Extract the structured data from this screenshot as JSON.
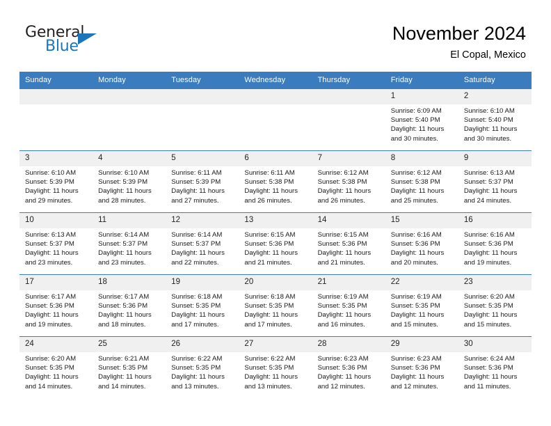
{
  "brand": {
    "name_part1": "General",
    "name_part2": "Blue",
    "triangle_color": "#1b75bb"
  },
  "header": {
    "month_title": "November 2024",
    "location": "El Copal, Mexico",
    "header_bg": "#3a7cbe",
    "daynum_bg": "#f0f0f0"
  },
  "weekday_headers": [
    "Sunday",
    "Monday",
    "Tuesday",
    "Wednesday",
    "Thursday",
    "Friday",
    "Saturday"
  ],
  "labels": {
    "sunrise_prefix": "Sunrise:",
    "sunset_prefix": "Sunset:",
    "daylight_prefix": "Daylight:"
  },
  "weeks": [
    [
      {
        "day": "",
        "empty": true
      },
      {
        "day": "",
        "empty": true
      },
      {
        "day": "",
        "empty": true
      },
      {
        "day": "",
        "empty": true
      },
      {
        "day": "",
        "empty": true
      },
      {
        "day": "1",
        "sunrise": "Sunrise: 6:09 AM",
        "sunset": "Sunset: 5:40 PM",
        "daylight_line1": "Daylight: 11 hours",
        "daylight_line2": "and 30 minutes."
      },
      {
        "day": "2",
        "sunrise": "Sunrise: 6:10 AM",
        "sunset": "Sunset: 5:40 PM",
        "daylight_line1": "Daylight: 11 hours",
        "daylight_line2": "and 30 minutes."
      }
    ],
    [
      {
        "day": "3",
        "sunrise": "Sunrise: 6:10 AM",
        "sunset": "Sunset: 5:39 PM",
        "daylight_line1": "Daylight: 11 hours",
        "daylight_line2": "and 29 minutes."
      },
      {
        "day": "4",
        "sunrise": "Sunrise: 6:10 AM",
        "sunset": "Sunset: 5:39 PM",
        "daylight_line1": "Daylight: 11 hours",
        "daylight_line2": "and 28 minutes."
      },
      {
        "day": "5",
        "sunrise": "Sunrise: 6:11 AM",
        "sunset": "Sunset: 5:39 PM",
        "daylight_line1": "Daylight: 11 hours",
        "daylight_line2": "and 27 minutes."
      },
      {
        "day": "6",
        "sunrise": "Sunrise: 6:11 AM",
        "sunset": "Sunset: 5:38 PM",
        "daylight_line1": "Daylight: 11 hours",
        "daylight_line2": "and 26 minutes."
      },
      {
        "day": "7",
        "sunrise": "Sunrise: 6:12 AM",
        "sunset": "Sunset: 5:38 PM",
        "daylight_line1": "Daylight: 11 hours",
        "daylight_line2": "and 26 minutes."
      },
      {
        "day": "8",
        "sunrise": "Sunrise: 6:12 AM",
        "sunset": "Sunset: 5:38 PM",
        "daylight_line1": "Daylight: 11 hours",
        "daylight_line2": "and 25 minutes."
      },
      {
        "day": "9",
        "sunrise": "Sunrise: 6:13 AM",
        "sunset": "Sunset: 5:37 PM",
        "daylight_line1": "Daylight: 11 hours",
        "daylight_line2": "and 24 minutes."
      }
    ],
    [
      {
        "day": "10",
        "sunrise": "Sunrise: 6:13 AM",
        "sunset": "Sunset: 5:37 PM",
        "daylight_line1": "Daylight: 11 hours",
        "daylight_line2": "and 23 minutes."
      },
      {
        "day": "11",
        "sunrise": "Sunrise: 6:14 AM",
        "sunset": "Sunset: 5:37 PM",
        "daylight_line1": "Daylight: 11 hours",
        "daylight_line2": "and 23 minutes."
      },
      {
        "day": "12",
        "sunrise": "Sunrise: 6:14 AM",
        "sunset": "Sunset: 5:37 PM",
        "daylight_line1": "Daylight: 11 hours",
        "daylight_line2": "and 22 minutes."
      },
      {
        "day": "13",
        "sunrise": "Sunrise: 6:15 AM",
        "sunset": "Sunset: 5:36 PM",
        "daylight_line1": "Daylight: 11 hours",
        "daylight_line2": "and 21 minutes."
      },
      {
        "day": "14",
        "sunrise": "Sunrise: 6:15 AM",
        "sunset": "Sunset: 5:36 PM",
        "daylight_line1": "Daylight: 11 hours",
        "daylight_line2": "and 21 minutes."
      },
      {
        "day": "15",
        "sunrise": "Sunrise: 6:16 AM",
        "sunset": "Sunset: 5:36 PM",
        "daylight_line1": "Daylight: 11 hours",
        "daylight_line2": "and 20 minutes."
      },
      {
        "day": "16",
        "sunrise": "Sunrise: 6:16 AM",
        "sunset": "Sunset: 5:36 PM",
        "daylight_line1": "Daylight: 11 hours",
        "daylight_line2": "and 19 minutes."
      }
    ],
    [
      {
        "day": "17",
        "sunrise": "Sunrise: 6:17 AM",
        "sunset": "Sunset: 5:36 PM",
        "daylight_line1": "Daylight: 11 hours",
        "daylight_line2": "and 19 minutes."
      },
      {
        "day": "18",
        "sunrise": "Sunrise: 6:17 AM",
        "sunset": "Sunset: 5:36 PM",
        "daylight_line1": "Daylight: 11 hours",
        "daylight_line2": "and 18 minutes."
      },
      {
        "day": "19",
        "sunrise": "Sunrise: 6:18 AM",
        "sunset": "Sunset: 5:35 PM",
        "daylight_line1": "Daylight: 11 hours",
        "daylight_line2": "and 17 minutes."
      },
      {
        "day": "20",
        "sunrise": "Sunrise: 6:18 AM",
        "sunset": "Sunset: 5:35 PM",
        "daylight_line1": "Daylight: 11 hours",
        "daylight_line2": "and 17 minutes."
      },
      {
        "day": "21",
        "sunrise": "Sunrise: 6:19 AM",
        "sunset": "Sunset: 5:35 PM",
        "daylight_line1": "Daylight: 11 hours",
        "daylight_line2": "and 16 minutes."
      },
      {
        "day": "22",
        "sunrise": "Sunrise: 6:19 AM",
        "sunset": "Sunset: 5:35 PM",
        "daylight_line1": "Daylight: 11 hours",
        "daylight_line2": "and 15 minutes."
      },
      {
        "day": "23",
        "sunrise": "Sunrise: 6:20 AM",
        "sunset": "Sunset: 5:35 PM",
        "daylight_line1": "Daylight: 11 hours",
        "daylight_line2": "and 15 minutes."
      }
    ],
    [
      {
        "day": "24",
        "sunrise": "Sunrise: 6:20 AM",
        "sunset": "Sunset: 5:35 PM",
        "daylight_line1": "Daylight: 11 hours",
        "daylight_line2": "and 14 minutes."
      },
      {
        "day": "25",
        "sunrise": "Sunrise: 6:21 AM",
        "sunset": "Sunset: 5:35 PM",
        "daylight_line1": "Daylight: 11 hours",
        "daylight_line2": "and 14 minutes."
      },
      {
        "day": "26",
        "sunrise": "Sunrise: 6:22 AM",
        "sunset": "Sunset: 5:35 PM",
        "daylight_line1": "Daylight: 11 hours",
        "daylight_line2": "and 13 minutes."
      },
      {
        "day": "27",
        "sunrise": "Sunrise: 6:22 AM",
        "sunset": "Sunset: 5:35 PM",
        "daylight_line1": "Daylight: 11 hours",
        "daylight_line2": "and 13 minutes."
      },
      {
        "day": "28",
        "sunrise": "Sunrise: 6:23 AM",
        "sunset": "Sunset: 5:36 PM",
        "daylight_line1": "Daylight: 11 hours",
        "daylight_line2": "and 12 minutes."
      },
      {
        "day": "29",
        "sunrise": "Sunrise: 6:23 AM",
        "sunset": "Sunset: 5:36 PM",
        "daylight_line1": "Daylight: 11 hours",
        "daylight_line2": "and 12 minutes."
      },
      {
        "day": "30",
        "sunrise": "Sunrise: 6:24 AM",
        "sunset": "Sunset: 5:36 PM",
        "daylight_line1": "Daylight: 11 hours",
        "daylight_line2": "and 11 minutes."
      }
    ]
  ]
}
